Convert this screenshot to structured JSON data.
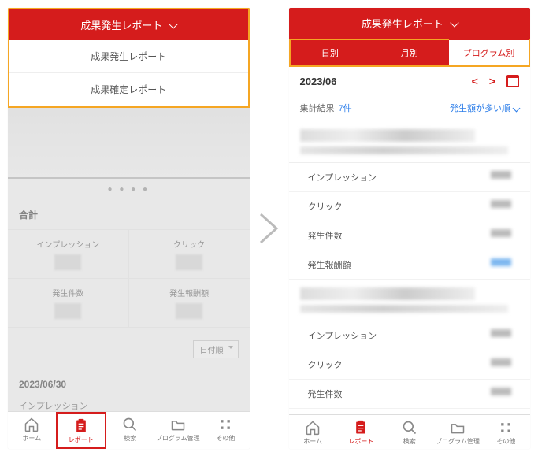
{
  "left": {
    "header_title": "成果発生レポート",
    "dropdown": [
      "成果発生レポート",
      "成果確定レポート"
    ],
    "total_label": "合計",
    "metrics2x2": [
      "インプレッション",
      "クリック",
      "発生件数",
      "発生報酬額"
    ],
    "sort_label": "日付順",
    "date": "2023/06/30",
    "row1": "インプレッション"
  },
  "right": {
    "header_title": "成果発生レポート",
    "tabs": [
      "日別",
      "月別",
      "プログラム別"
    ],
    "active_tab": 2,
    "date": "2023/06",
    "summary_label": "集計結果",
    "summary_count": "7件",
    "sort_label": "発生額が多い順",
    "metrics": [
      "インプレッション",
      "クリック",
      "発生件数",
      "発生報酬額"
    ]
  },
  "bottombar": {
    "items": [
      "ホーム",
      "レポート",
      "検索",
      "プログラム管理",
      "その他"
    ],
    "active": 1
  }
}
